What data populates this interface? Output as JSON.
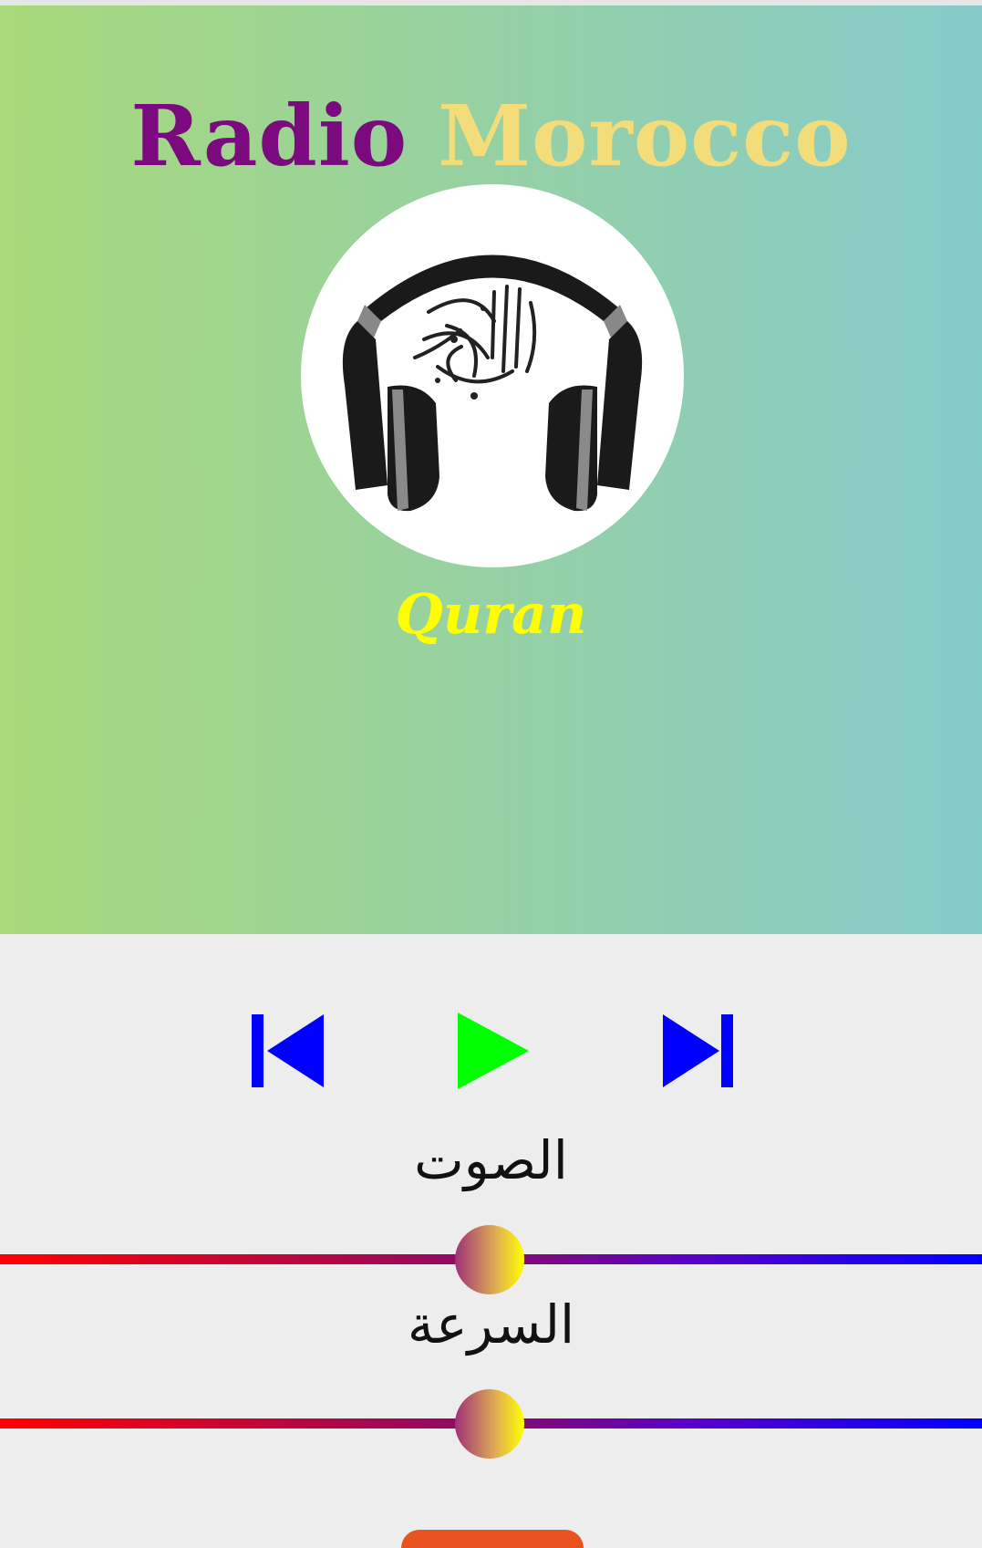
{
  "header": {
    "title_word1": "Radio",
    "title_word2": "Morocco",
    "subtitle": "Quran",
    "title_color1": "#7a0a7e",
    "title_color2": "#f2dd7a",
    "subtitle_color": "#ffff00",
    "logo_icon": "headphones-quran-icon"
  },
  "controls": {
    "previous_icon": "skip-previous-icon",
    "play_icon": "play-icon",
    "next_icon": "skip-next-icon",
    "previous_color": "#0000ff",
    "play_color": "#00ff00",
    "next_color": "#0000ff"
  },
  "volume": {
    "label": "الصوت",
    "level_fraction": 0.5
  },
  "speed": {
    "label": "السرعة",
    "level_fraction": 0.5
  }
}
